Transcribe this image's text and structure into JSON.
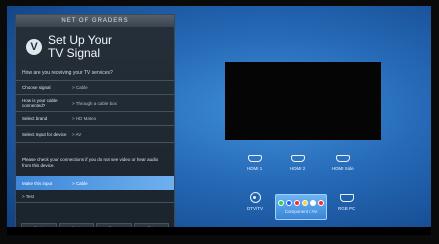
{
  "panel": {
    "top_label": "NET OF GRADERS",
    "logo_letter": "V",
    "title_line1": "Set Up Your",
    "title_line2": "TV Signal",
    "question": "How are you receiving your TV services?",
    "rows": [
      {
        "label": "Choose signal",
        "value": "> Cable"
      },
      {
        "label": "How is your cable connected?",
        "value": "> Through a cable box"
      },
      {
        "label": "Select brand",
        "value": "> HD Mateo"
      },
      {
        "label": "Select Input for device",
        "value": "> AV"
      }
    ],
    "note": "Please check your connections if you do not see video or hear audio from this device.",
    "selected_row": {
      "label": "Make this input",
      "value": "> Cable"
    },
    "subitem": "> Test",
    "buttons": [
      "Back",
      "Next",
      "Done",
      "Skip"
    ]
  },
  "inputs": [
    {
      "label": "HDMI 1",
      "icon": "hdmi-icon"
    },
    {
      "label": "HDMI 2",
      "icon": "hdmi-icon"
    },
    {
      "label": "HDMI Side",
      "icon": "hdmi-icon"
    },
    {
      "label": "DTV/TV",
      "icon": "coax-icon"
    },
    {
      "label": "Component / AV",
      "icon": "component-icon"
    },
    {
      "label": "RGB PC",
      "icon": "vga-icon"
    }
  ],
  "colors": {
    "component_dots": [
      "#2bd14a",
      "#2b59ff",
      "#ff2b2b",
      "#ffd12b",
      "#ffffff",
      "#ff2b2b"
    ]
  }
}
